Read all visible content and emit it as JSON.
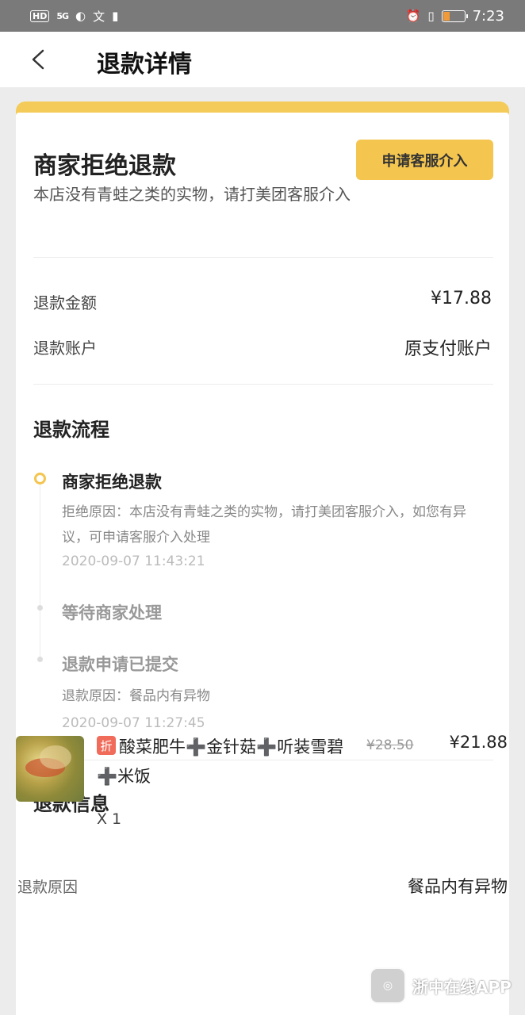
{
  "status_bar": {
    "hd": "HD",
    "signal": "5G",
    "time": "7:23",
    "battery_level": 0.3,
    "battery_color": "#f09a3a"
  },
  "header": {
    "back_icon": "chevron-left-icon",
    "title": "退款详情"
  },
  "status": {
    "title": "商家拒绝退款",
    "description": "本店没有青蛙之类的实物，请打美团客服介入",
    "cs_button": "申请客服介入"
  },
  "refund_info": {
    "amount_label": "退款金额",
    "amount_value": "¥17.88",
    "account_label": "退款账户",
    "account_value": "原支付账户"
  },
  "process": {
    "title": "退款流程",
    "steps": [
      {
        "title": "商家拒绝退款",
        "text": "拒绝原因：本店没有青蛙之类的实物，请打美团客服介入，如您有异议，可申请客服介入处理",
        "time": "2020-09-07 11:43:21"
      },
      {
        "title": "等待商家处理"
      },
      {
        "title": "退款申请已提交",
        "text": "退款原因：餐品内有异物",
        "time": "2020-09-07 11:27:45"
      }
    ]
  },
  "refund_detail": {
    "title": "退款信息",
    "item": {
      "badge": "折",
      "name": "酸菜肥牛➕金针菇➕听装雪碧➕米饭",
      "original_price": "¥28.50",
      "price": "¥21.88",
      "quantity": "X 1"
    },
    "reason_label": "退款原因",
    "reason_value": "餐品内有异物"
  },
  "watermark": {
    "text": "浙中在线APP"
  },
  "colors": {
    "accent": "#f4c54f",
    "band": "#f4cb58",
    "badge": "#f06b5a"
  }
}
